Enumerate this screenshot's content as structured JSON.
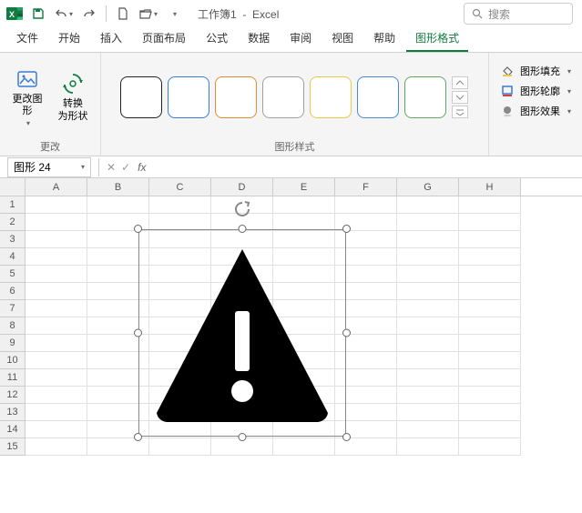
{
  "title": {
    "workbook": "工作簿1",
    "app": "Excel"
  },
  "search": {
    "placeholder": "搜索"
  },
  "tabs": [
    "文件",
    "开始",
    "插入",
    "页面布局",
    "公式",
    "数据",
    "审阅",
    "视图",
    "帮助",
    "图形格式"
  ],
  "activeTab": 9,
  "ribbon": {
    "groupChange": {
      "label": "更改",
      "changeGraphic": "更改图\n形",
      "convertToShape": "转换\n为形状"
    },
    "groupStyles": {
      "label": "图形样式"
    },
    "shapeFormat": {
      "fill": "图形填充",
      "outline": "图形轮廓",
      "effects": "图形效果"
    }
  },
  "nameBox": "图形 24",
  "columns": [
    "A",
    "B",
    "C",
    "D",
    "E",
    "F",
    "G",
    "H"
  ],
  "rowCount": 15,
  "styleSwatches": [
    {
      "border": "#222"
    },
    {
      "border": "#3a7bd5"
    },
    {
      "border": "#e38b2f"
    },
    {
      "border": "#a0a0a0"
    },
    {
      "border": "#e8c84a"
    },
    {
      "border": "#4a88d8"
    },
    {
      "border": "#5fa863"
    }
  ]
}
